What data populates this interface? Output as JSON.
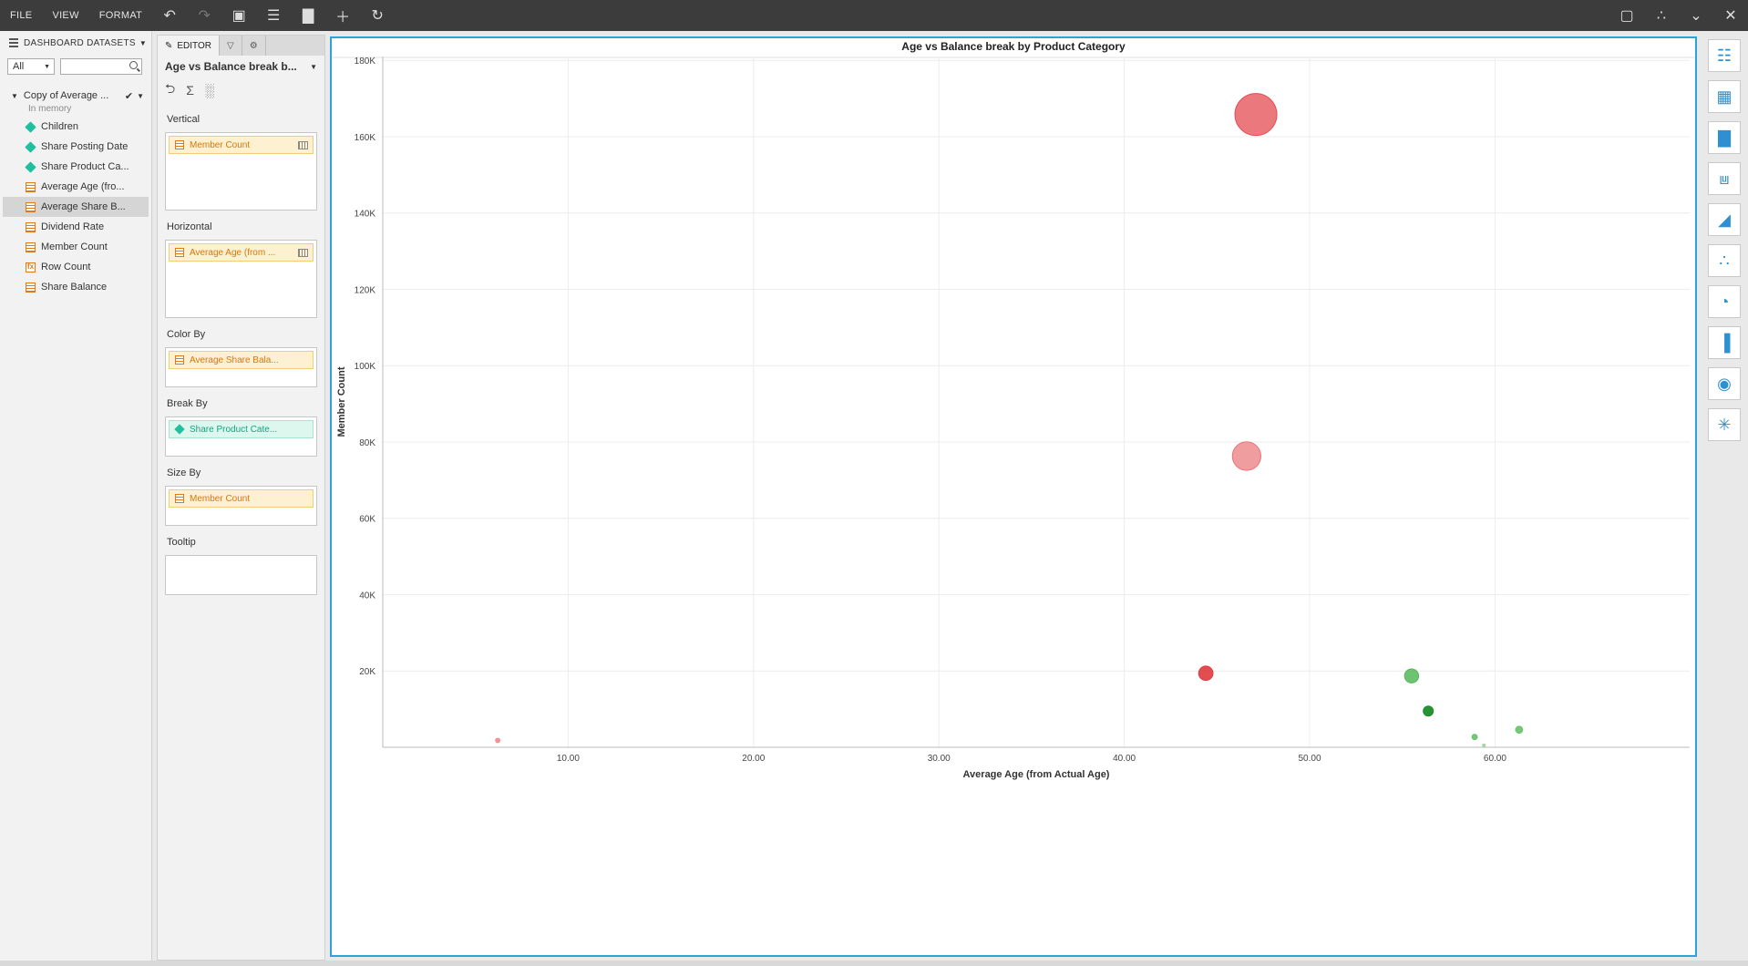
{
  "menu": [
    "FILE",
    "VIEW",
    "FORMAT"
  ],
  "left_panel": {
    "header": "DASHBOARD DATASETS",
    "filter_value": "All",
    "search_placeholder": "",
    "dataset_name": "Copy of Average ...",
    "dataset_sub": "In memory",
    "fields": [
      {
        "label": "Children",
        "kind": "dim"
      },
      {
        "label": "Share Posting Date",
        "kind": "dim"
      },
      {
        "label": "Share Product Ca...",
        "kind": "dim"
      },
      {
        "label": "Average Age (fro...",
        "kind": "meas"
      },
      {
        "label": "Average Share B...",
        "kind": "meas",
        "selected": true
      },
      {
        "label": "Dividend Rate",
        "kind": "meas"
      },
      {
        "label": "Member Count",
        "kind": "meas"
      },
      {
        "label": "Row Count",
        "kind": "calc"
      },
      {
        "label": "Share Balance",
        "kind": "meas"
      }
    ]
  },
  "editor": {
    "tab_editor": "EDITOR",
    "title": "Age vs Balance break b...",
    "shelves": {
      "vertical": {
        "label": "Vertical",
        "pill": "Member Count"
      },
      "horizontal": {
        "label": "Horizontal",
        "pill": "Average Age (from ..."
      },
      "color": {
        "label": "Color By",
        "pill": "Average Share Bala..."
      },
      "break": {
        "label": "Break By",
        "pill": "Share Product Cate..."
      },
      "size": {
        "label": "Size By",
        "pill": "Member Count"
      },
      "tooltip": {
        "label": "Tooltip",
        "pill": ""
      }
    }
  },
  "chart_data": {
    "type": "scatter",
    "title": "Age vs Balance break by Product Category",
    "xlabel": "Average Age (from Actual Age)",
    "ylabel": "Member Count",
    "xlim": [
      0,
      70.5
    ],
    "ylim": [
      0,
      181000
    ],
    "xticks": [
      10,
      20,
      30,
      40,
      50,
      60
    ],
    "xtick_labels": [
      "10.00",
      "20.00",
      "30.00",
      "40.00",
      "50.00",
      "60.00"
    ],
    "yticks": [
      20000,
      40000,
      60000,
      80000,
      100000,
      120000,
      140000,
      160000,
      180000
    ],
    "ytick_labels": [
      "20K",
      "40K",
      "60K",
      "80K",
      "100K",
      "120K",
      "140K",
      "160K",
      "180K"
    ],
    "grid": true,
    "points": [
      {
        "x": 47.1,
        "y": 165800,
        "color": "#e34b50",
        "opacity": 0.75
      },
      {
        "x": 46.6,
        "y": 76300,
        "color": "#ea7377",
        "opacity": 0.7
      },
      {
        "x": 44.4,
        "y": 19400,
        "color": "#e0393e",
        "opacity": 0.9
      },
      {
        "x": 55.5,
        "y": 18700,
        "color": "#55b85a",
        "opacity": 0.85
      },
      {
        "x": 56.4,
        "y": 9500,
        "color": "#1d8c2a",
        "opacity": 0.95
      },
      {
        "x": 61.3,
        "y": 4600,
        "color": "#66c266",
        "opacity": 0.9
      },
      {
        "x": 58.9,
        "y": 2700,
        "color": "#66c266",
        "opacity": 0.9
      },
      {
        "x": 6.2,
        "y": 1800,
        "color": "#f08a8d",
        "opacity": 0.9
      },
      {
        "x": 59.4,
        "y": 500,
        "color": "#9fd69f",
        "opacity": 0.9
      }
    ],
    "sizes": [
      165800,
      76300,
      19400,
      18700,
      9500,
      4600,
      2700,
      1800,
      500
    ]
  }
}
